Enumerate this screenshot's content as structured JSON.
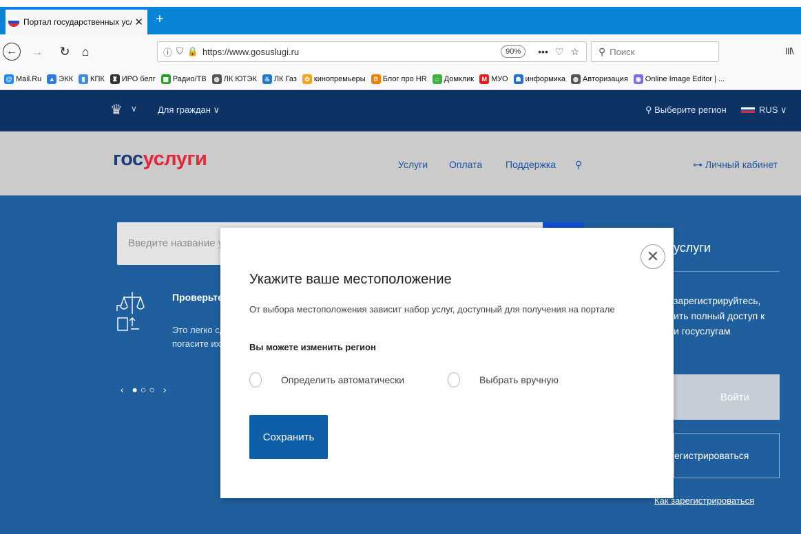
{
  "browser": {
    "tab_title": "Портал государственных услуг",
    "tab_close": "✕",
    "new_tab": "+",
    "url": "https://www.gosuslugi.ru",
    "zoom": "90%",
    "page_actions": "•••",
    "search_placeholder": "Поиск",
    "library_icon": "III\\",
    "bookmarks": [
      {
        "label": "Mail.Ru",
        "color": "#1b8cff",
        "glyph": "@"
      },
      {
        "label": "ЭКК",
        "color": "#2f7de1",
        "glyph": "▲"
      },
      {
        "label": "КПК",
        "color": "#3a8de0",
        "glyph": "▮"
      },
      {
        "label": "ИРО белг",
        "color": "#333333",
        "glyph": "♜"
      },
      {
        "label": "Радио/ТВ",
        "color": "#2a9a2a",
        "glyph": "▦"
      },
      {
        "label": "ЛК ЮТЭК",
        "color": "#555555",
        "glyph": "◍"
      },
      {
        "label": "ЛК Газ",
        "color": "#1f7ad0",
        "glyph": "♨"
      },
      {
        "label": "кинопремьеры",
        "color": "#f7a21b",
        "glyph": "✿"
      },
      {
        "label": "Блог про HR",
        "color": "#f57c00",
        "glyph": "B"
      },
      {
        "label": "Домклик",
        "color": "#40b040",
        "glyph": "⌂"
      },
      {
        "label": "МУО",
        "color": "#e01e1e",
        "glyph": "M"
      },
      {
        "label": "информика",
        "color": "#1f6fd0",
        "glyph": "☗"
      },
      {
        "label": "Авторизация",
        "color": "#555555",
        "glyph": "◍"
      },
      {
        "label": "Online Image Editor | ...",
        "color": "#7a6ee0",
        "glyph": "◉"
      }
    ]
  },
  "site": {
    "citizens_menu": "Для граждан ∨",
    "region_link": "Выберите регион",
    "lang": "RUS ∨",
    "logo_part1": "гос",
    "logo_part2": "услуги",
    "nav": {
      "services": "Услуги",
      "payment": "Оплата",
      "support": "Поддержка"
    },
    "personal_cabinet": "Личный кабинет",
    "search_placeholder": "Введите название ус",
    "check_title": "Проверьте",
    "check_text_1": "Это легко сд",
    "check_text_2": "погасите их",
    "carousel": "‹ ●○○ ›",
    "right_title": "услуги",
    "right_text_1": "зарегистрируйтесь,",
    "right_text_2": "ить полный доступ к",
    "right_text_3": "и госуслугам",
    "login": "Войти",
    "register": "егистрироваться",
    "how_register": "Как зарегистрироваться"
  },
  "modal": {
    "title": "Укажите ваше местоположение",
    "description": "От выбора местоположения зависит набор услуг, доступный для получения на портале",
    "subtitle": "Вы можете изменить регион",
    "option_auto": "Определить автоматически",
    "option_manual": "Выбрать вручную",
    "save": "Сохранить",
    "close": "✕"
  }
}
